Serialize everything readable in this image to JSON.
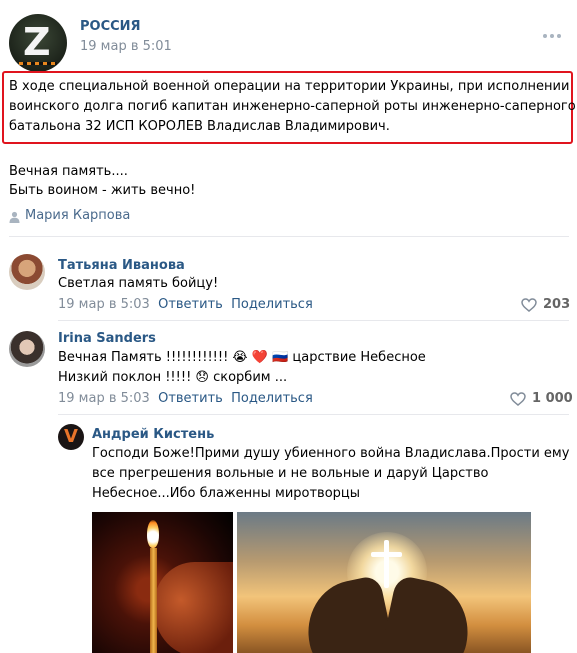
{
  "post": {
    "author": "РОССИЯ",
    "date": "19 мар в 5:01",
    "more_icon": "more-dots-icon",
    "highlighted_lines": [
      "В ходе специальной военной операции на территории Украины, при исполнении",
      "воинского долга погиб капитан инженерно-саперной роты инженерно-саперного",
      "батальона 32 ИСП КОРОЛЕВ Владислав Владимирович."
    ],
    "text_lines": [
      "Вечная память....",
      "Быть воином - жить вечно!"
    ],
    "signer_icon": "person-icon",
    "signer": "Мария Карпова"
  },
  "comments": [
    {
      "author": "Татьяна Иванова",
      "lines": [
        "Светлая память бойцу!"
      ],
      "date": "19 мар в 5:03",
      "reply": "Ответить",
      "share": "Поделиться",
      "likes": "203"
    },
    {
      "author": "Irina Sanders",
      "lines": [
        "Вечная Память !!!!!!!!!!!! 😭 ❤️ 🇷🇺 царствие Небесное",
        "Низкий поклон !!!!! 😞 скорбим ..."
      ],
      "date": "19 мар в 5:03",
      "reply": "Ответить",
      "share": "Поделиться",
      "likes": "1 000"
    },
    {
      "author": "Андрей Кистень",
      "lines": [
        "Господи Боже!Прими душу убиенного война Владислава.Прости ему",
        "все прегрешения вольные и не вольные и даруй Царство",
        "Небесное...Ибо блаженны миротворцы"
      ]
    }
  ],
  "colors": {
    "link": "#2a5885",
    "meta": "#818c99",
    "highlight_border": "#e0141e"
  }
}
